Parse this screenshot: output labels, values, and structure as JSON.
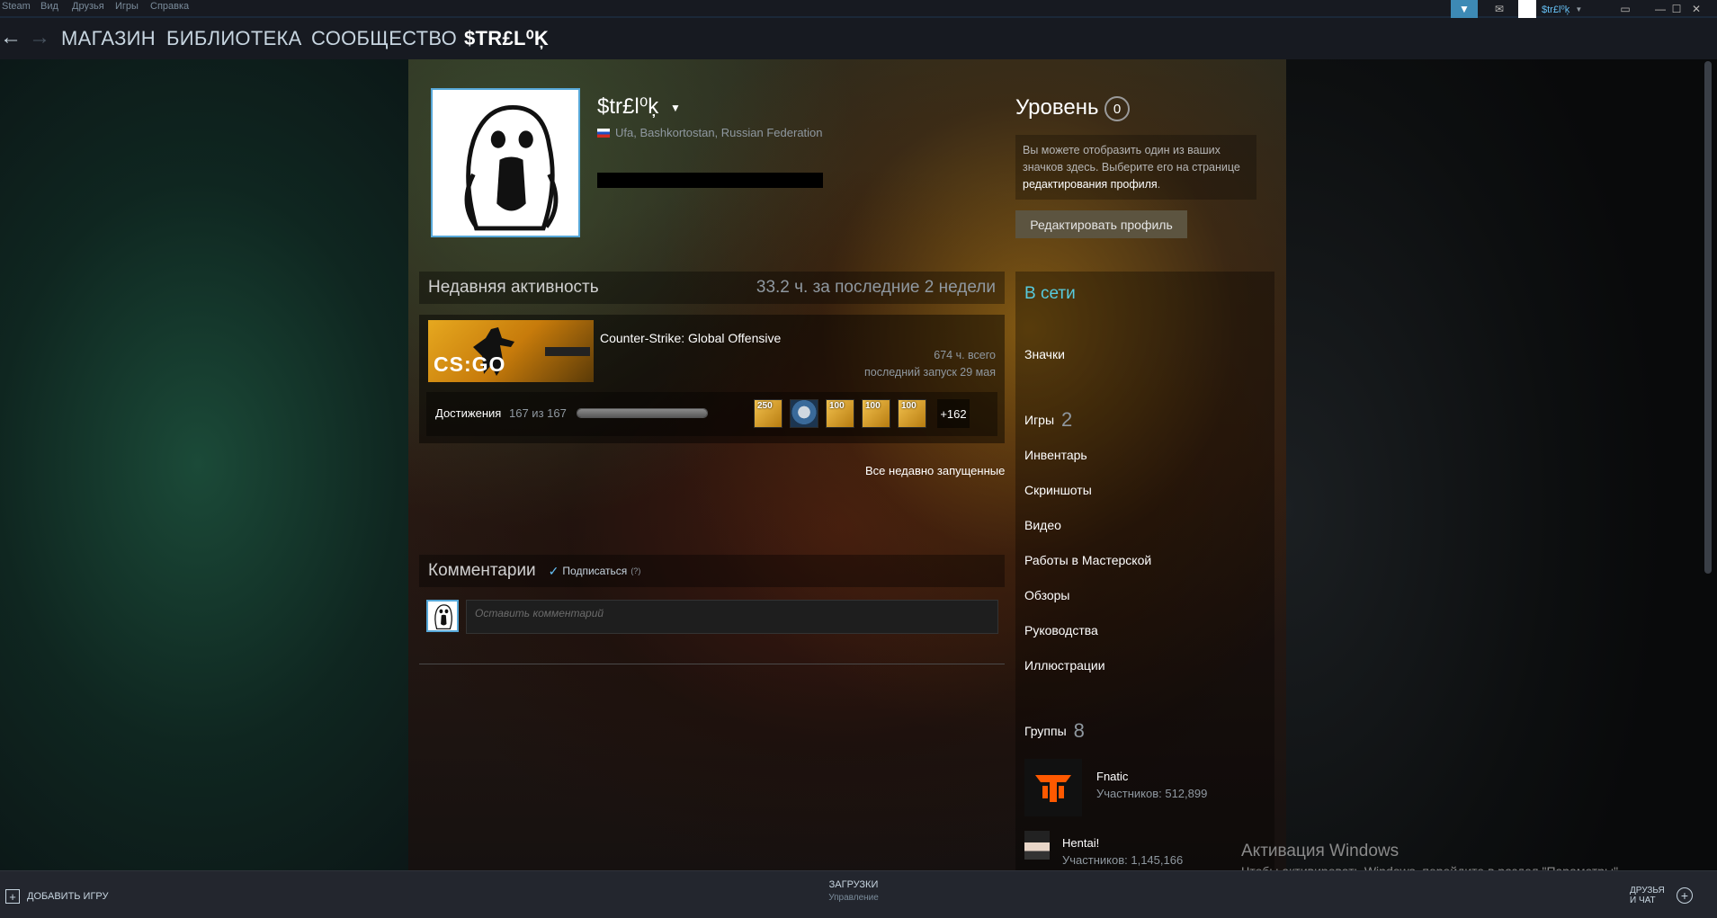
{
  "menu": {
    "items": [
      "Steam",
      "Вид",
      "Друзья",
      "Игры",
      "Справка"
    ],
    "username": "$tr£l⁰ķ"
  },
  "nav": {
    "back_icon": "arrow-left-icon",
    "forward_icon": "arrow-right-icon",
    "store": "МАГАЗИН",
    "library": "БИБЛИОТЕКА",
    "community": "СООБЩЕСТВО",
    "profile": "$TR£L⁰Ķ"
  },
  "profile": {
    "persona_name": "$tr£l⁰ķ",
    "location": "Ufa, Bashkortostan, Russian Federation",
    "level_label": "Уровень",
    "level": "0",
    "badge_hint_prefix": "Вы можете отобразить один из ваших значков здесь. Выберите его на странице ",
    "badge_hint_link": "редактирования профиля",
    "badge_hint_suffix": ".",
    "edit_profile": "Редактировать профиль"
  },
  "activity": {
    "title": "Недавняя активность",
    "summary": "33.2 ч. за последние 2 недели",
    "game": {
      "cover_text": "CS:GO",
      "name": "Counter-Strike: Global Offensive",
      "hours": "674 ч. всего",
      "last_played": "последний запуск 29 мая",
      "achievements_label": "Достижения",
      "achievements_count": "167 из 167",
      "achievements_progress": 1.0,
      "achievement_icons": [
        {
          "label": "250",
          "style": "gold"
        },
        {
          "label": "",
          "style": "blue"
        },
        {
          "label": "100",
          "style": "gold"
        },
        {
          "label": "100",
          "style": "gold"
        },
        {
          "label": "100",
          "style": "gold"
        }
      ],
      "more_achievements": "+162"
    },
    "all_recent": "Все недавно запущенные"
  },
  "comments": {
    "title": "Комментарии",
    "subscribe": "Подписаться",
    "help": "(?)",
    "placeholder": "Оставить комментарий"
  },
  "sidebar": {
    "status": "В сети",
    "badges": "Значки",
    "games": "Игры",
    "games_count": "2",
    "inventory": "Инвентарь",
    "screenshots": "Скриншоты",
    "videos": "Видео",
    "workshop": "Работы в Мастерской",
    "reviews": "Обзоры",
    "guides": "Руководства",
    "artwork": "Иллюстрации",
    "groups": "Группы",
    "groups_count": "8",
    "group_list": [
      {
        "name": "Fnatic",
        "members": "Участников: 512,899"
      },
      {
        "name": "Hentai!",
        "members": "Участников: 1,145,166"
      }
    ]
  },
  "watermark": {
    "title": "Активация Windows",
    "text": "Чтобы активировать Windows, перейдите в раздел \"Параметры\"."
  },
  "bottom": {
    "add_game": "ДОБАВИТЬ ИГРУ",
    "downloads": "ЗАГРУЗКИ",
    "downloads_sub": "Управление",
    "friends_line1": "ДРУЗЬЯ",
    "friends_line2": "И ЧАТ"
  },
  "colors": {
    "accent_blue": "#66c0f4",
    "online": "#57cbde",
    "menubar": "#171a21"
  }
}
